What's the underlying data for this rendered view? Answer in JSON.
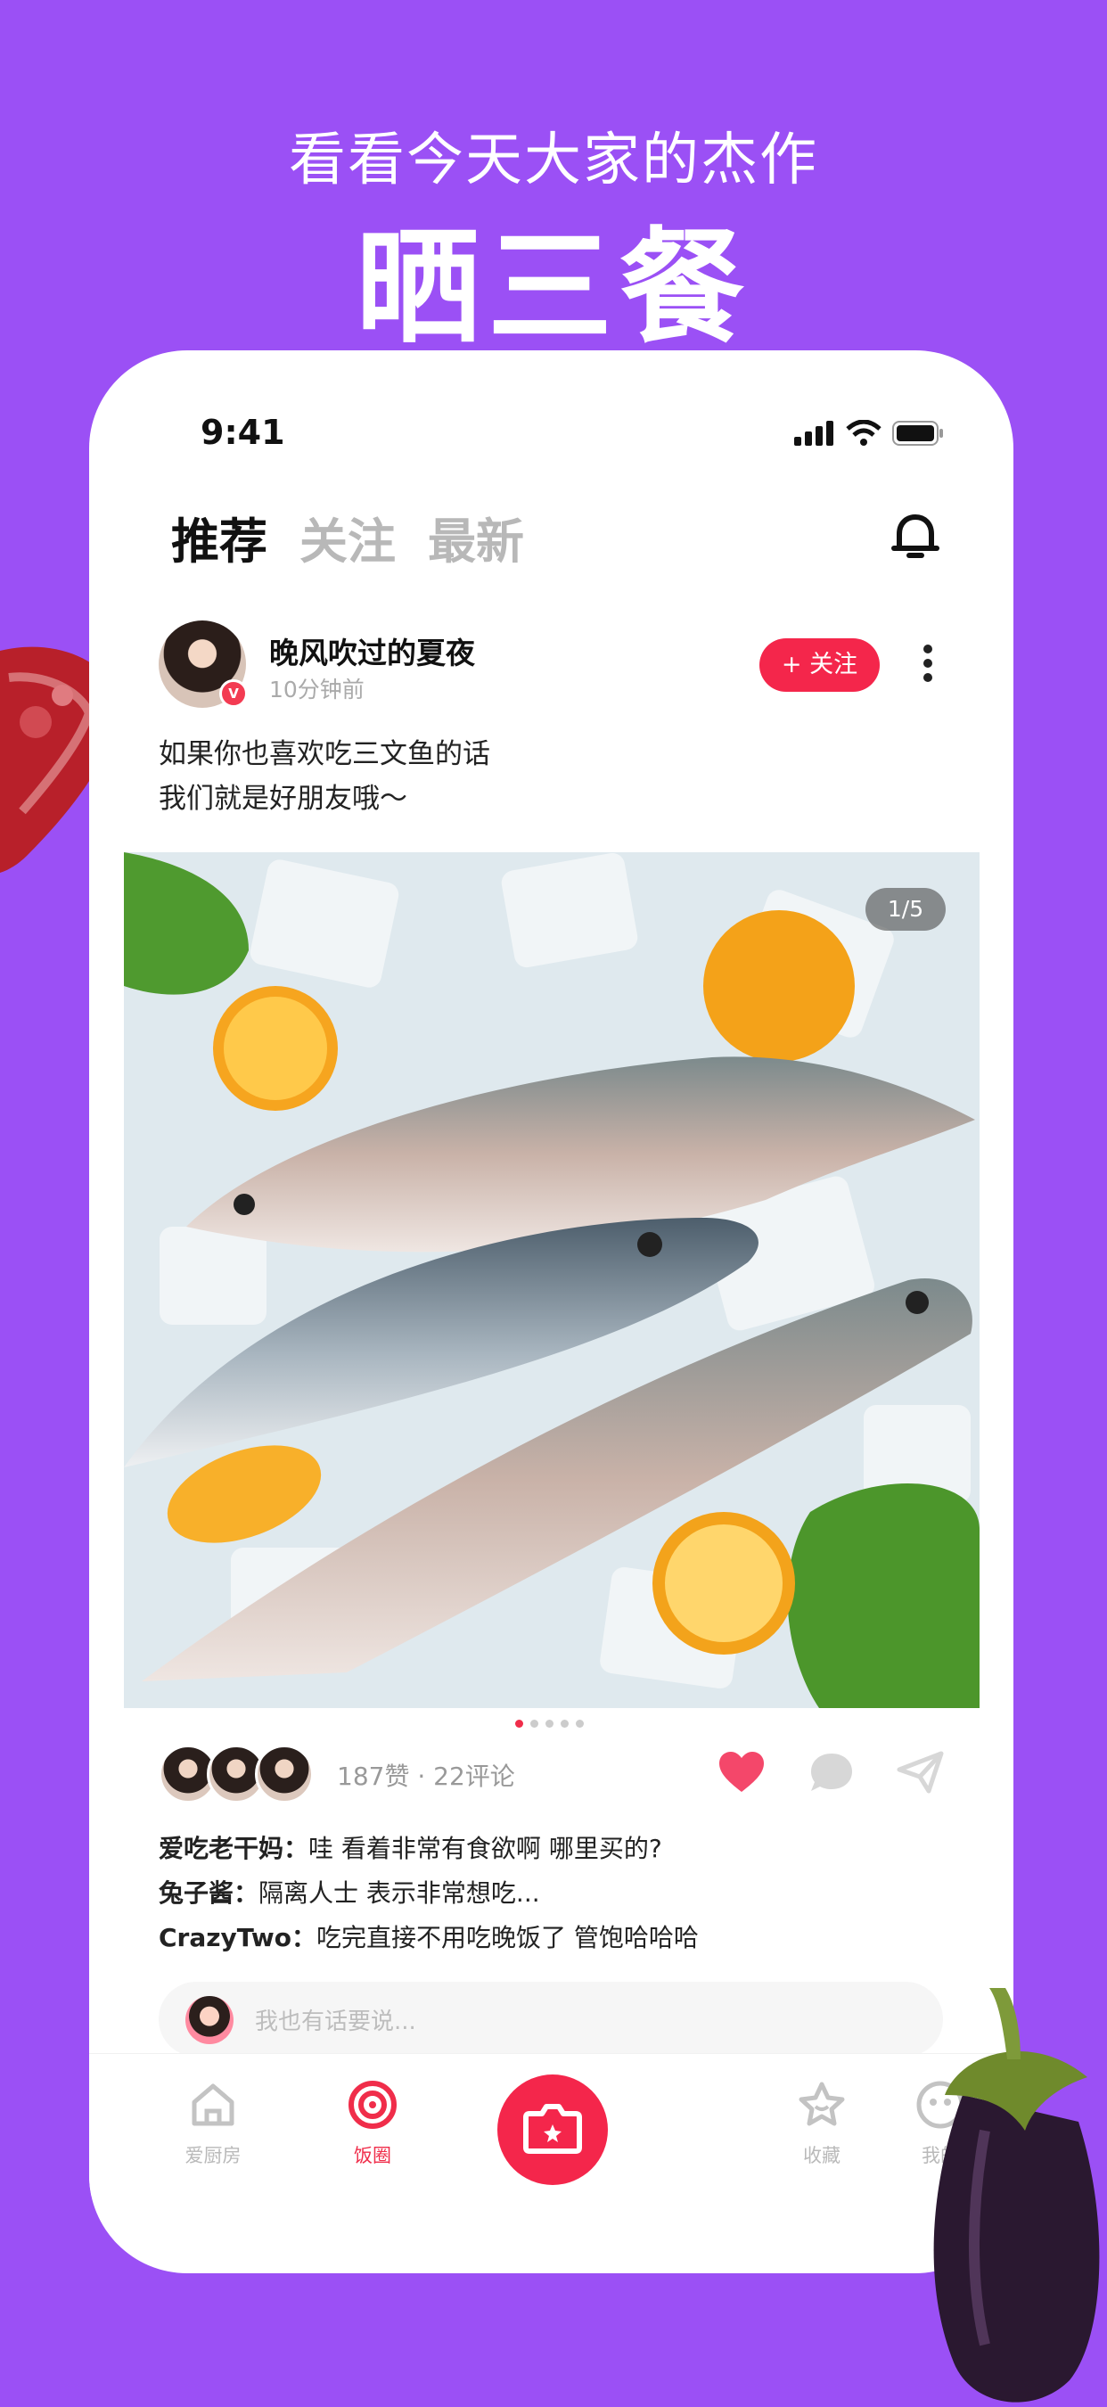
{
  "promo": {
    "subtitle": "看看今天大家的杰作",
    "title": "晒三餐"
  },
  "status_bar": {
    "time": "9:41"
  },
  "feed_tabs": [
    {
      "label": "推荐",
      "active": true
    },
    {
      "label": "关注",
      "active": false
    },
    {
      "label": "最新",
      "active": false
    }
  ],
  "post": {
    "author_name": "晚风吹过的夏夜",
    "posted_time": "10分钟前",
    "verified_badge": "V",
    "follow_label": "+ 关注",
    "caption_line1": "如果你也喜欢吃三文鱼的话",
    "caption_line2": "我们就是好朋友哦～",
    "image_counter": "1/5",
    "image_subject": "fish-on-ice",
    "stats": "187赞 · 22评论",
    "liked": true,
    "comments": [
      {
        "user": "爱吃老干妈：",
        "text": "哇 看着非常有食欲啊 哪里买的?"
      },
      {
        "user": "兔子酱：",
        "text": "隔离人士 表示非常想吃..."
      },
      {
        "user": "CrazyTwo：",
        "text": "吃完直接不用吃晚饭了 管饱哈哈哈"
      }
    ],
    "reply_placeholder": "我也有话要说..."
  },
  "bottom_nav": [
    {
      "label": "爱厨房",
      "icon": "home-icon",
      "active": false
    },
    {
      "label": "饭圈",
      "icon": "target-icon",
      "active": true
    },
    {
      "label": "",
      "icon": "camera-icon",
      "active": false
    },
    {
      "label": "收藏",
      "icon": "star-icon",
      "active": false
    },
    {
      "label": "我的",
      "icon": "face-icon",
      "active": false
    }
  ],
  "colors": {
    "background": "#9b50f5",
    "accent": "#f4264b",
    "heart": "#f4476a"
  }
}
